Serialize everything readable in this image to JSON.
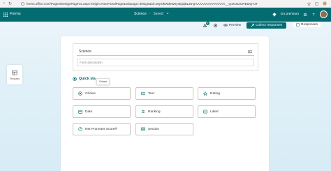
{
  "browser": {
    "url": "forms.office.com/Pages/DesignPageV2.aspx?origin=NeoPortalPage&subpage=design&id=DQSIkWdsW0yxEjajBLZtrQAAAAAAAAAAAAAA__Q1KJZJUREt3QTJT"
  },
  "appbar": {
    "app_name": "Forms",
    "form_name": "Science",
    "saved_label": "Saved",
    "premium_label": "Go premium",
    "notification_count": "1"
  },
  "command": {
    "preview_label": "Preview",
    "collect_label": "Collect responses",
    "responses_label": "Responses"
  },
  "rail": {
    "templates_label": "Templates"
  },
  "form": {
    "title_value": "Science",
    "description_placeholder": "Form description"
  },
  "quickstart": {
    "label": "Quick sta",
    "tooltip": "Choice",
    "options": [
      {
        "label": "Choice"
      },
      {
        "label": "Text"
      },
      {
        "label": "Rating"
      },
      {
        "label": "Date"
      },
      {
        "label": "Ranking"
      },
      {
        "label": "Likert"
      },
      {
        "label": "Net Promoter Score®"
      },
      {
        "label": "Section"
      }
    ]
  },
  "colors": {
    "brand": "#036c70",
    "page_background": "#e3f1f8"
  }
}
